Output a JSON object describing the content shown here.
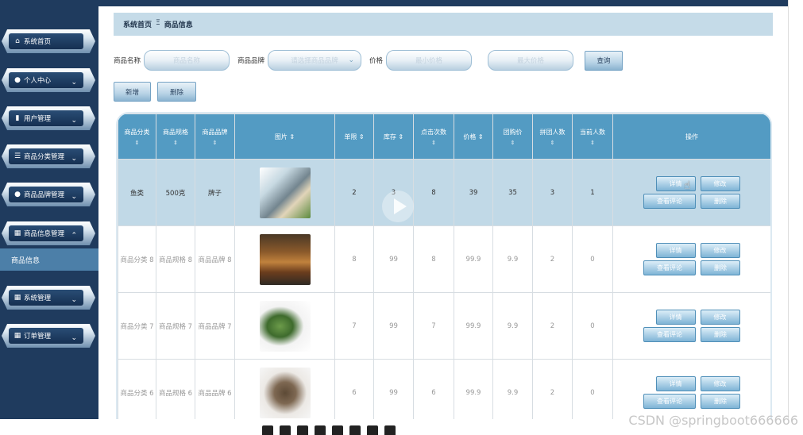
{
  "sidebar": {
    "items": [
      {
        "label": "系统首页",
        "icon": "home-icon"
      },
      {
        "label": "个人中心",
        "icon": "user-icon"
      },
      {
        "label": "用户管理",
        "icon": "bar-chart-icon"
      },
      {
        "label": "商品分类管理",
        "icon": "list-icon"
      },
      {
        "label": "商品品牌管理",
        "icon": "user-icon"
      },
      {
        "label": "商品信息管理",
        "icon": "grid-icon"
      },
      {
        "label": "系统管理",
        "icon": "grid-icon"
      },
      {
        "label": "订单管理",
        "icon": "grid-icon"
      }
    ],
    "active_sub": "商品信息"
  },
  "breadcrumb": {
    "home": "系统首页",
    "sep": "Ξ",
    "current": "商品信息"
  },
  "search": {
    "name_label": "商品名称",
    "name_placeholder": "商品名称",
    "brand_label": "商品品牌",
    "brand_placeholder": "请选择商品品牌",
    "price_label": "价格",
    "min_price_placeholder": "最小价格",
    "max_price_placeholder": "最大价格",
    "query": "查询"
  },
  "actions": {
    "add": "新增",
    "delete": "删除"
  },
  "table": {
    "headers": [
      "商品分类",
      "商品规格",
      "商品品牌",
      "图片",
      "单限",
      "库存",
      "点击次数",
      "价格",
      "团购价",
      "拼团人数",
      "当前人数",
      "操作"
    ],
    "sort_icon": "⇕",
    "rows": [
      {
        "category": "鱼类",
        "spec": "500克",
        "brand": "牌子",
        "image": "fish",
        "limit": "2",
        "stock": "3",
        "clicks": "8",
        "price": "39",
        "group_price": "35",
        "group_size": "3",
        "current": "1"
      },
      {
        "category": "商品分类 8",
        "spec": "商品规格 8",
        "brand": "商品品牌 8",
        "image": "jars",
        "limit": "8",
        "stock": "99",
        "clicks": "8",
        "price": "99.9",
        "group_price": "9.9",
        "group_size": "2",
        "current": "0"
      },
      {
        "category": "商品分类 7",
        "spec": "商品规格 7",
        "brand": "商品品牌 7",
        "image": "cuke",
        "limit": "7",
        "stock": "99",
        "clicks": "7",
        "price": "99.9",
        "group_price": "9.9",
        "group_size": "2",
        "current": "0"
      },
      {
        "category": "商品分类 6",
        "spec": "商品规格 6",
        "brand": "商品品牌 6",
        "image": "root",
        "limit": "6",
        "stock": "99",
        "clicks": "6",
        "price": "99.9",
        "group_price": "9.9",
        "group_size": "2",
        "current": "0"
      }
    ],
    "op_detail": "详情",
    "op_edit": "修改",
    "op_comments": "查看评论",
    "op_delete": "删除"
  },
  "watermark": "CSDN @springboot666666"
}
